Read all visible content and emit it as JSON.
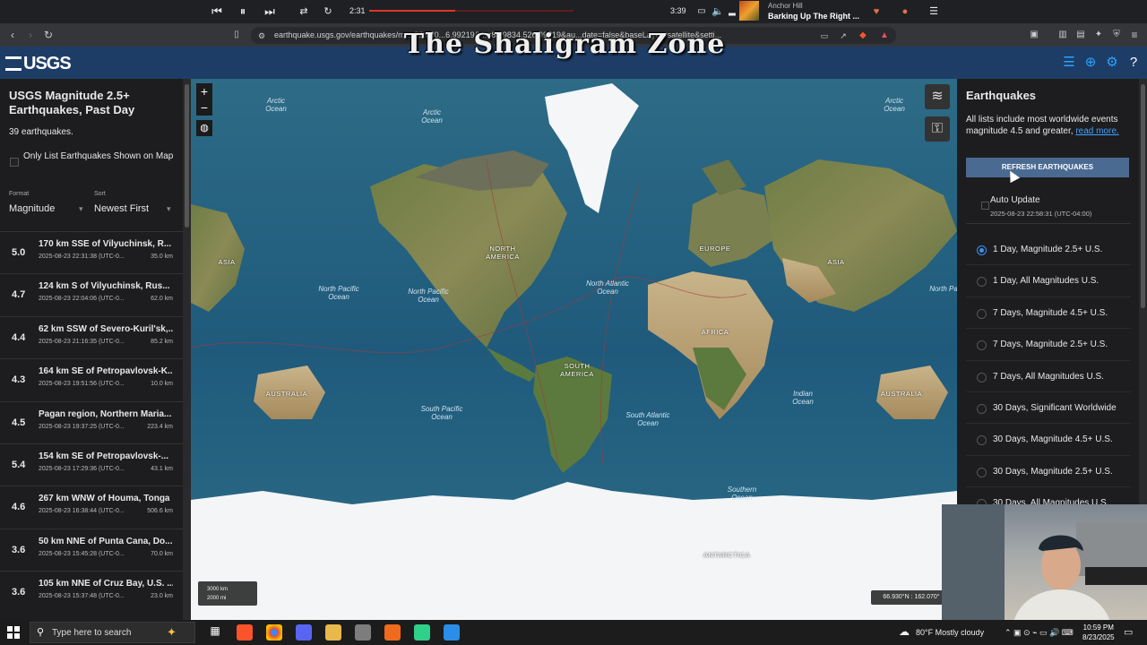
{
  "media": {
    "elapsed": "2:31",
    "duration": "3:39",
    "progress_fraction": 0.42,
    "artist": "Anchor Hill",
    "track": "Barking Up The Right ..."
  },
  "browser": {
    "url": "earthquake.usgs.gov/earthquakes/m...-82.940...6.99219&...=82.9834,526.99219&au...date=false&baseLayer=satellite&setti..."
  },
  "overlay_title": "The Shaligram Zone",
  "usgs": {
    "logo": "USGS"
  },
  "left_panel": {
    "title": "USGS Magnitude 2.5+ Earthquakes, Past Day",
    "count": "39 earthquakes.",
    "only_list_label": "Only List Earthquakes Shown on Map",
    "format_label": "Format",
    "format_value": "Magnitude",
    "sort_label": "Sort",
    "sort_value": "Newest First",
    "earthquakes": [
      {
        "mag": "5.0",
        "place": "170 km SSE of Vilyuchinsk, R...",
        "time": "2025-08-23 22:31:38 (UTC-0...",
        "depth": "35.0 km"
      },
      {
        "mag": "4.7",
        "place": "124 km S of Vilyuchinsk, Rus...",
        "time": "2025-08-23 22:04:06 (UTC-0...",
        "depth": "62.0 km"
      },
      {
        "mag": "4.4",
        "place": "62 km SSW of Severo-Kuril'sk,...",
        "time": "2025-08-23 21:16:35 (UTC-0...",
        "depth": "85.2 km"
      },
      {
        "mag": "4.3",
        "place": "164 km SE of Petropavlovsk-K...",
        "time": "2025-08-23 19:51:56 (UTC-0...",
        "depth": "10.0 km"
      },
      {
        "mag": "4.5",
        "place": "Pagan region, Northern Maria...",
        "time": "2025-08-23 19:37:25 (UTC-0...",
        "depth": "223.4 km"
      },
      {
        "mag": "5.4",
        "place": "154 km SE of Petropavlovsk-...",
        "time": "2025-08-23 17:29:36 (UTC-0...",
        "depth": "43.1 km"
      },
      {
        "mag": "4.6",
        "place": "267 km WNW of Houma, Tonga",
        "time": "2025-08-23 16:38:44 (UTC-0...",
        "depth": "506.6 km"
      },
      {
        "mag": "3.6",
        "place": "50 km NNE of Punta Cana, Do...",
        "time": "2025-08-23 15:45:28 (UTC-0...",
        "depth": "70.0 km"
      },
      {
        "mag": "3.6",
        "place": "105 km NNE of Cruz Bay, U.S. ...",
        "time": "2025-08-23 15:37:48 (UTC-0...",
        "depth": "23.0 km"
      }
    ]
  },
  "map": {
    "zoom_in": "+",
    "zoom_out": "−",
    "labels": {
      "arctic_ocean_left": "Arctic Ocean",
      "arctic_ocean_center": "Arctic Ocean",
      "arctic_ocean_right": "Arctic Ocean",
      "asia_left": "ASIA",
      "asia_right": "ASIA",
      "north_america": "NORTH AMERICA",
      "europe": "EUROPE",
      "africa": "AFRICA",
      "south_america": "SOUTH AMERICA",
      "australia_left": "AUSTRALIA",
      "australia_right": "AUSTRALIA",
      "antarctica": "ANTARCTICA",
      "north_pacific_left": "North Pacific Ocean",
      "north_pacific_center": "North Pacific Ocean",
      "north_pacific_right": "North Pac",
      "north_atlantic": "North Atlantic Ocean",
      "south_pacific": "South Pacific Ocean",
      "south_atlantic": "South Atlantic Ocean",
      "indian_ocean": "Indian Ocean",
      "southern_ocean": "Southern Ocean"
    },
    "scale_km": "3000 km",
    "scale_mi": "2000 mi",
    "coordinates": "66.930°N : 162.070°"
  },
  "right_panel": {
    "title": "Earthquakes",
    "description": "All lists include most worldwide events magnitude 4.5 and greater,",
    "read_more": "read more.",
    "refresh_button": "REFRESH EARTHQUAKES",
    "auto_update_label": "Auto Update",
    "auto_update_time": "2025-08-23 22:58:31 (UTC-04:00)",
    "feeds": [
      {
        "label": "1 Day, Magnitude 2.5+ U.S.",
        "selected": true
      },
      {
        "label": "1 Day, All Magnitudes U.S.",
        "selected": false
      },
      {
        "label": "7 Days, Magnitude 4.5+ U.S.",
        "selected": false
      },
      {
        "label": "7 Days, Magnitude 2.5+ U.S.",
        "selected": false
      },
      {
        "label": "7 Days, All Magnitudes U.S.",
        "selected": false
      },
      {
        "label": "30 Days, Significant Worldwide",
        "selected": false
      },
      {
        "label": "30 Days, Magnitude 4.5+ U.S.",
        "selected": false
      },
      {
        "label": "30 Days, Magnitude 2.5+ U.S.",
        "selected": false
      },
      {
        "label": "30 Days, All Magnitudes U.S.",
        "selected": false
      }
    ]
  },
  "taskbar": {
    "search_placeholder": "Type here to search",
    "weather": "80°F  Mostly cloudy",
    "time": "10:59 PM",
    "date": "8/23/2025"
  }
}
